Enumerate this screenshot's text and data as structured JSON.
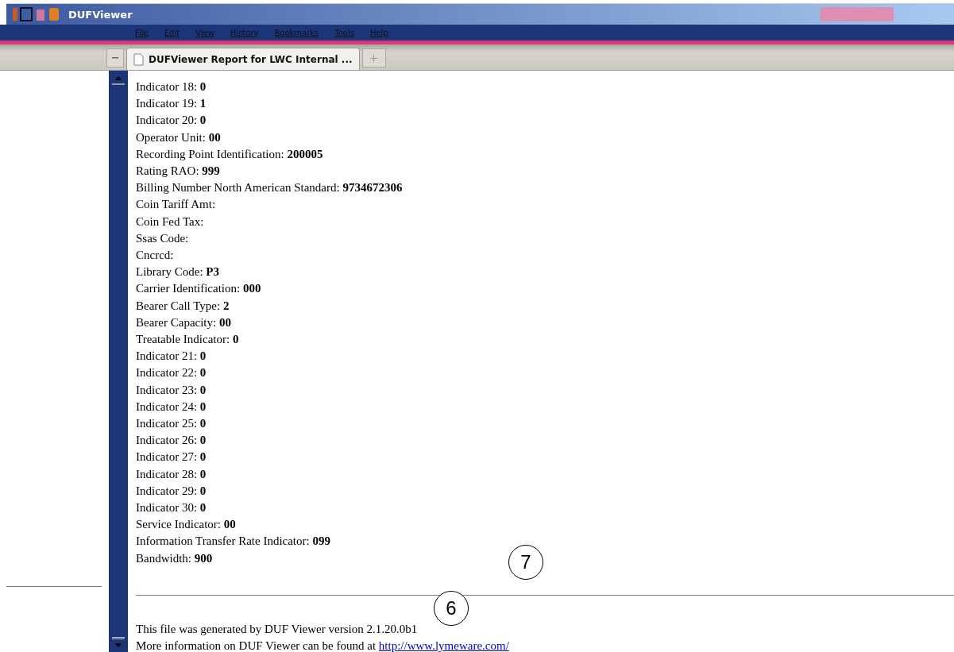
{
  "window": {
    "title": "DUFViewer"
  },
  "menu": [
    "File",
    "Edit",
    "View",
    "History",
    "Bookmarks",
    "Tools",
    "Help"
  ],
  "tabs": [
    {
      "label": "DUFViewer Report for LWC Internal ...",
      "selected": true
    }
  ],
  "fields": [
    {
      "label": "Indicator 18:",
      "value": "0"
    },
    {
      "label": "Indicator 19:",
      "value": "1"
    },
    {
      "label": "Indicator 20:",
      "value": "0"
    },
    {
      "label": "Operator Unit:",
      "value": "00"
    },
    {
      "label": "Recording Point Identification:",
      "value": "200005"
    },
    {
      "label": "Rating RAO:",
      "value": "999"
    },
    {
      "label": "Billing Number North American Standard:",
      "value": "9734672306"
    },
    {
      "label": "Coin Tariff Amt:"
    },
    {
      "label": "Coin Fed Tax:"
    },
    {
      "label": "Ssas Code:"
    },
    {
      "label": "Cncrcd:"
    },
    {
      "label": "Library Code:",
      "value": "P3"
    },
    {
      "label": "Carrier Identification:",
      "value": "000"
    },
    {
      "label": "Bearer Call Type:",
      "value": "2"
    },
    {
      "label": "Bearer Capacity:",
      "value": "00"
    },
    {
      "label": "Treatable Indicator:",
      "value": "0"
    },
    {
      "label": "Indicator 21:",
      "value": "0"
    },
    {
      "label": "Indicator 22:",
      "value": "0"
    },
    {
      "label": "Indicator 23:",
      "value": "0"
    },
    {
      "label": "Indicator 24:",
      "value": "0"
    },
    {
      "label": "Indicator 25:",
      "value": "0"
    },
    {
      "label": "Indicator 26:",
      "value": "0"
    },
    {
      "label": "Indicator 27:",
      "value": "0"
    },
    {
      "label": "Indicator 28:",
      "value": "0"
    },
    {
      "label": "Indicator 29:",
      "value": "0"
    },
    {
      "label": "Indicator 30:",
      "value": "0"
    },
    {
      "label": "Service Indicator:",
      "value": "00"
    },
    {
      "label": "Information Transfer Rate Indicator:",
      "value": "099"
    },
    {
      "label": "Bandwidth:",
      "value": "900"
    }
  ],
  "footer": {
    "generated": "This file was generated by DUF Viewer version 2.1.20.0b1",
    "more_info": "More information on DUF Viewer can be found at",
    "link": "http://www.lymeware.com/"
  },
  "callouts": [
    "7",
    "6"
  ]
}
